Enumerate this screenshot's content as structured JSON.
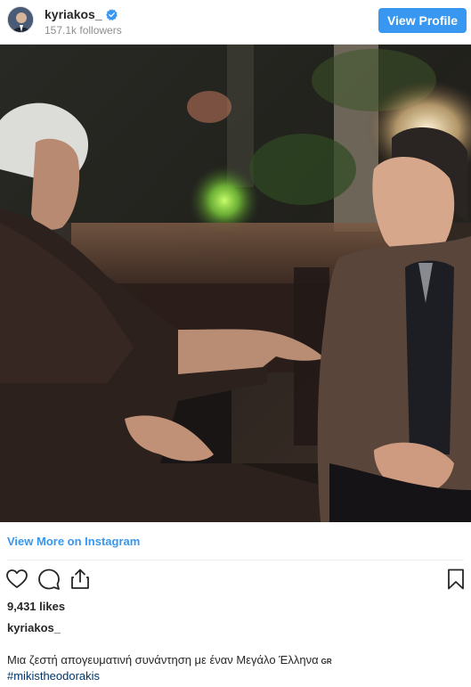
{
  "header": {
    "username": "kyriakos_",
    "followers": "157.1k followers",
    "view_profile_label": "View Profile",
    "accent_color": "#3897f0"
  },
  "post": {
    "view_more_label": "View More on Instagram",
    "likes": "9,431 likes",
    "caption_username": "kyriakos_",
    "caption_text": "Μια ζεστή απογευματινή συνάντηση με έναν Μεγάλο Έλληνα",
    "caption_flag": "GR",
    "hashtag": "#mikistheodorakis",
    "link_color": "#003569"
  },
  "icons": {
    "like": "heart-icon",
    "comment": "comment-icon",
    "share": "share-icon",
    "save": "bookmark-icon",
    "verified": "verified-badge-icon"
  }
}
